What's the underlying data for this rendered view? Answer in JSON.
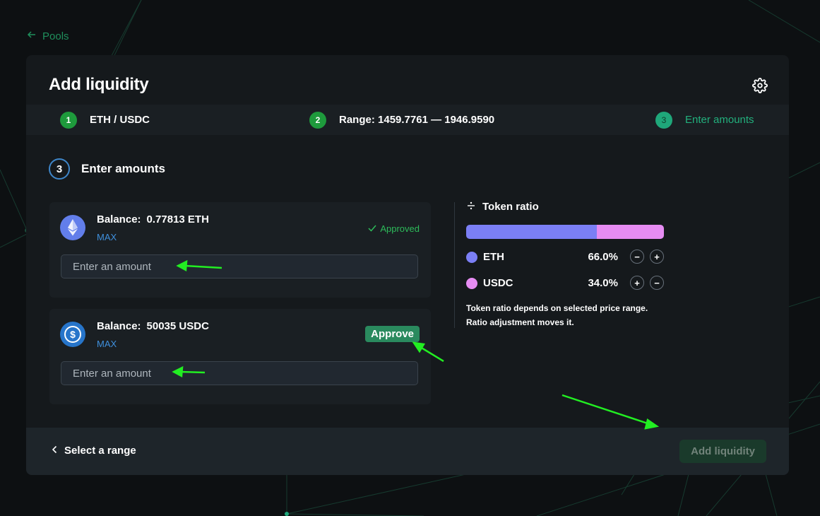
{
  "nav": {
    "back_label": "Pools"
  },
  "header": {
    "title": "Add liquidity"
  },
  "steps": [
    {
      "number": "1",
      "label": "ETH / USDC"
    },
    {
      "number": "2",
      "label": "Range: 1459.7761 — 1946.9590"
    },
    {
      "number": "3",
      "label": "Enter amounts"
    }
  ],
  "section": {
    "number": "3",
    "label": "Enter amounts"
  },
  "tokens": [
    {
      "balance_label": "Balance:",
      "balance_value": "0.77813 ETH",
      "max_label": "MAX",
      "status_label": "Approved",
      "input_placeholder": "Enter an amount",
      "icon": "eth-icon"
    },
    {
      "balance_label": "Balance:",
      "balance_value": "50035 USDC",
      "max_label": "MAX",
      "action_label": "Approve",
      "input_placeholder": "Enter an amount",
      "icon": "usdc-icon"
    }
  ],
  "ratio": {
    "title": "Token ratio",
    "bar": [
      {
        "name": "ETH",
        "fraction": 0.66,
        "color": "#7b7ff5"
      },
      {
        "name": "USDC",
        "fraction": 0.34,
        "color": "#e68cf2"
      }
    ],
    "rows": [
      {
        "name": "ETH",
        "percent": "66.0%",
        "color": "#7b7ff5"
      },
      {
        "name": "USDC",
        "percent": "34.0%",
        "color": "#e68cf2"
      }
    ],
    "note_line1": "Token ratio depends on selected price range.",
    "note_line2": "Ratio adjustment moves it."
  },
  "footer": {
    "back_label": "Select a range",
    "submit_label": "Add liquidity"
  },
  "colors": {
    "accent": "#22b07d",
    "step_done": "#1e9a3c",
    "max_link": "#3f8fdc",
    "approved": "#2dbb5a",
    "annotation_arrow": "#22ee22"
  }
}
